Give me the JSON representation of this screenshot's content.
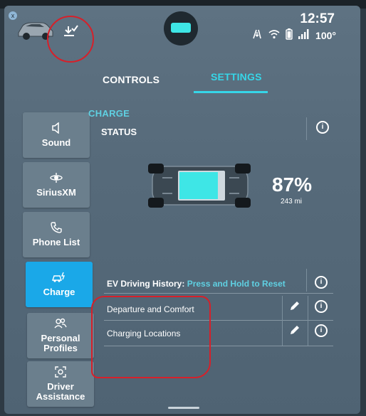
{
  "status_bar": {
    "badge": "x",
    "time": "12:57",
    "battery_percent": "100°",
    "icons": [
      "car-icon",
      "download-check-icon",
      "center-app-icon",
      "gps-icon",
      "wifi-icon",
      "phone-battery-icon",
      "signal-icon"
    ]
  },
  "tabs": [
    {
      "label": "CONTROLS",
      "active": false
    },
    {
      "label": "SETTINGS",
      "active": true
    }
  ],
  "sidebar": {
    "items": [
      {
        "label": "Sound",
        "icon": "speaker-icon",
        "active": false
      },
      {
        "label": "SiriusXM",
        "icon": "satellite-icon",
        "active": false
      },
      {
        "label": "Phone List",
        "icon": "phone-icon",
        "active": false
      },
      {
        "label": "Charge",
        "icon": "ev-charge-icon",
        "active": true
      },
      {
        "label": "Personal Profiles",
        "icon": "profiles-icon",
        "active": false
      },
      {
        "label": "Driver Assistance",
        "icon": "driver-assist-icon",
        "active": false
      }
    ]
  },
  "charge": {
    "section_title": "CHARGE",
    "status_title": "STATUS",
    "soc_percent": "87%",
    "soc_fill": 0.87,
    "range": "243 mi",
    "ev_history_label": "EV Driving History:",
    "ev_history_action": "Press and Hold to Reset",
    "rows": [
      {
        "label": "Departure and Comfort"
      },
      {
        "label": "Charging Locations"
      }
    ]
  },
  "colors": {
    "accent": "#36d6e8",
    "active_sidebar": "#1aa8e8",
    "annotation": "#d6202a",
    "battery_fill": "#3ee6e6"
  }
}
